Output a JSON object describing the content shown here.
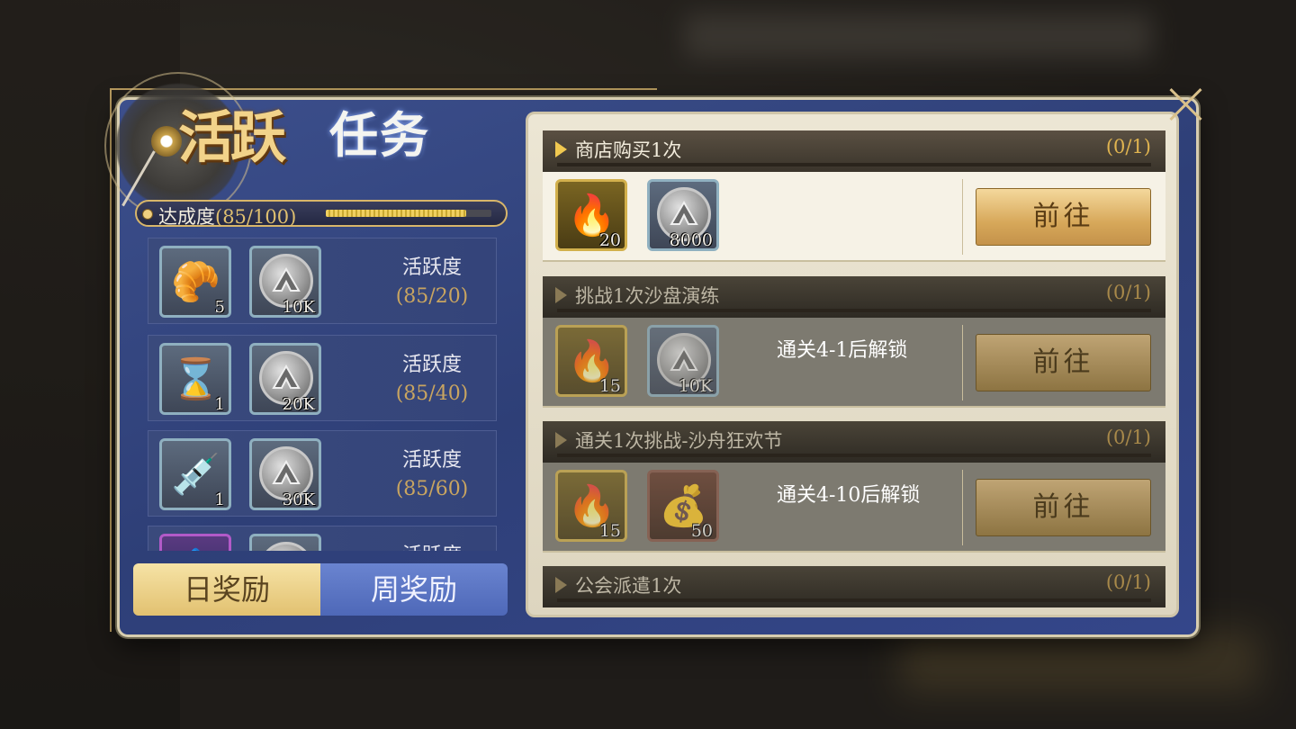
{
  "window": {
    "title_part1": "活跃",
    "title_part2": "任务"
  },
  "progress": {
    "label": "达成度",
    "count": "(85/100)",
    "fraction": 0.85
  },
  "rewards": [
    {
      "items": [
        {
          "icon": "croissant-icon",
          "qty": "5"
        },
        {
          "icon": "silver-coin-icon",
          "qty": "10K"
        }
      ],
      "label": "活跃度",
      "count": "(85/20)"
    },
    {
      "items": [
        {
          "icon": "hourglass-icon",
          "qty": "1"
        },
        {
          "icon": "silver-coin-icon",
          "qty": "20K"
        }
      ],
      "label": "活跃度",
      "count": "(85/40)"
    },
    {
      "items": [
        {
          "icon": "syringe-icon",
          "qty": "1"
        },
        {
          "icon": "silver-coin-icon",
          "qty": "30K"
        }
      ],
      "label": "活跃度",
      "count": "(85/60)"
    },
    {
      "items": [
        {
          "icon": "crystal-icon",
          "qty": ""
        },
        {
          "icon": "silver-coin-icon",
          "qty": ""
        }
      ],
      "label": "活跃度",
      "count": ""
    }
  ],
  "tabs": {
    "daily": "日奖励",
    "weekly": "周奖励"
  },
  "tasks": [
    {
      "title": "商店购买1次",
      "progress": "(0/1)",
      "rewards": [
        {
          "icon": "gold-token-icon",
          "qty": "20"
        },
        {
          "icon": "silver-coin-icon",
          "qty": "8000"
        }
      ],
      "lock_text": "",
      "button": "前往",
      "locked": false
    },
    {
      "title": "挑战1次沙盘演练",
      "progress": "(0/1)",
      "rewards": [
        {
          "icon": "gold-token-icon",
          "qty": "15"
        },
        {
          "icon": "silver-coin-icon",
          "qty": "10K"
        }
      ],
      "lock_text": "通关4-1后解锁",
      "button": "前往",
      "locked": true
    },
    {
      "title": "通关1次挑战-沙舟狂欢节",
      "progress": "(0/1)",
      "rewards": [
        {
          "icon": "gold-token-icon",
          "qty": "15"
        },
        {
          "icon": "sack-icon",
          "qty": "50"
        }
      ],
      "lock_text": "通关4-10后解锁",
      "button": "前往",
      "locked": true
    },
    {
      "title": "公会派遣1次",
      "progress": "(0/1)",
      "rewards": [],
      "lock_text": "",
      "button": "",
      "locked": true
    }
  ],
  "colors": {
    "panel": "#34468a",
    "accent_gold": "#e0c070",
    "button": "#d7a85a"
  }
}
